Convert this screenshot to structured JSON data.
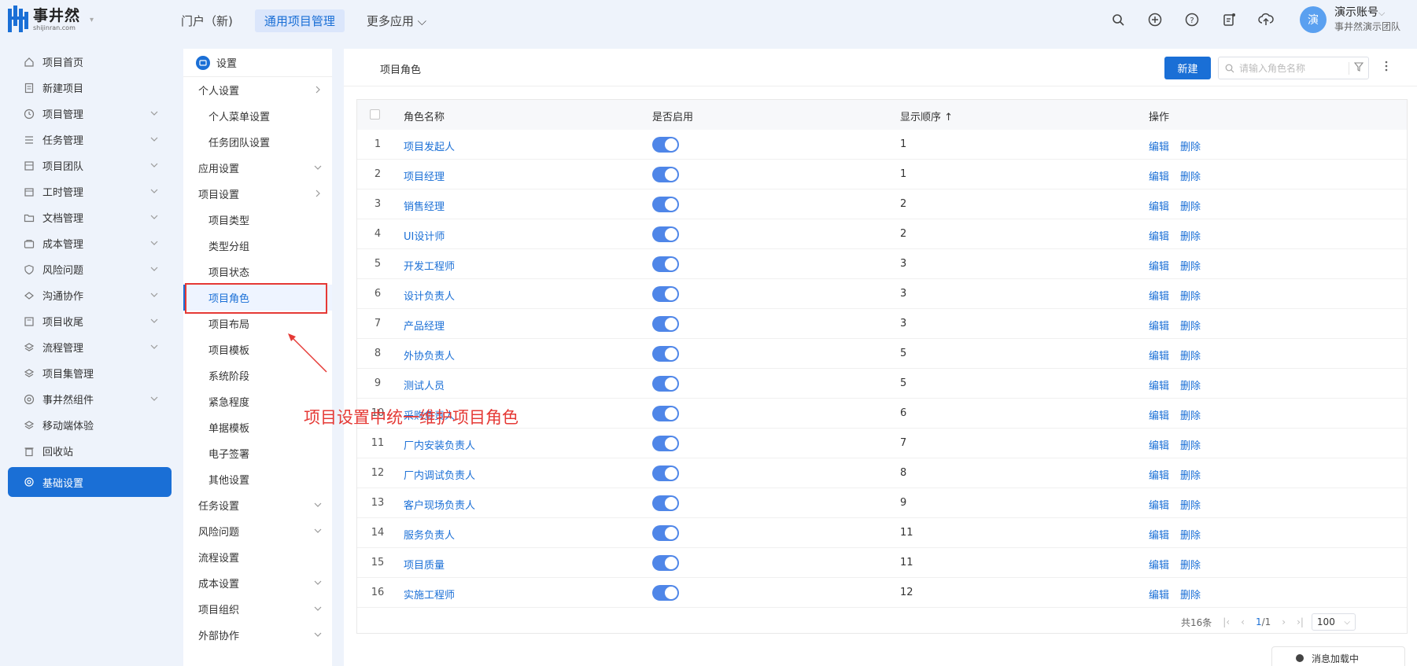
{
  "brand": {
    "name": "事井然",
    "sub": "shijinran.com"
  },
  "topnav": [
    {
      "label": "门户（新)",
      "active": false
    },
    {
      "label": "通用项目管理",
      "active": true
    },
    {
      "label": "更多应用 ⌵",
      "active": false
    }
  ],
  "top_icons": [
    "search-icon",
    "plus-circle-icon",
    "help-icon",
    "notice-icon",
    "cloud-upload-icon"
  ],
  "user": {
    "avatar": "演",
    "name": "演示账号",
    "team": "事井然演示团队"
  },
  "sidebar": [
    {
      "label": "项目首页",
      "icon": "home-icon",
      "chev": false
    },
    {
      "label": "新建项目",
      "icon": "doc-icon",
      "chev": false
    },
    {
      "label": "项目管理",
      "icon": "clock-icon",
      "chev": true
    },
    {
      "label": "任务管理",
      "icon": "list-icon",
      "chev": true
    },
    {
      "label": "项目团队",
      "icon": "team-icon",
      "chev": true
    },
    {
      "label": "工时管理",
      "icon": "calendar-icon",
      "chev": true
    },
    {
      "label": "文档管理",
      "icon": "folder-icon",
      "chev": true
    },
    {
      "label": "成本管理",
      "icon": "wallet-icon",
      "chev": true
    },
    {
      "label": "风险问题",
      "icon": "shield-icon",
      "chev": true
    },
    {
      "label": "沟通协作",
      "icon": "chat-icon",
      "chev": true
    },
    {
      "label": "项目收尾",
      "icon": "archive-icon",
      "chev": true
    },
    {
      "label": "流程管理",
      "icon": "flow-icon",
      "chev": true
    },
    {
      "label": "项目集管理",
      "icon": "layers-icon",
      "chev": false
    },
    {
      "label": "事井然组件",
      "icon": "at-icon",
      "chev": true
    },
    {
      "label": "移动端体验",
      "icon": "mobile-icon",
      "chev": false
    },
    {
      "label": "回收站",
      "icon": "trash-icon",
      "chev": false
    },
    {
      "label": "基础设置",
      "icon": "gear-icon",
      "chev": false,
      "active": true
    }
  ],
  "settings": {
    "title": "设置",
    "items": [
      {
        "label": "个人设置",
        "type": "group",
        "chev": "right"
      },
      {
        "label": "个人菜单设置",
        "type": "sub"
      },
      {
        "label": "任务团队设置",
        "type": "sub"
      },
      {
        "label": "应用设置",
        "type": "group",
        "chev": "down"
      },
      {
        "label": "项目设置",
        "type": "group",
        "chev": "right"
      },
      {
        "label": "项目类型",
        "type": "sub"
      },
      {
        "label": "类型分组",
        "type": "sub"
      },
      {
        "label": "项目状态",
        "type": "sub"
      },
      {
        "label": "项目角色",
        "type": "sub",
        "selected": true
      },
      {
        "label": "项目布局",
        "type": "sub"
      },
      {
        "label": "项目模板",
        "type": "sub"
      },
      {
        "label": "系统阶段",
        "type": "sub"
      },
      {
        "label": "紧急程度",
        "type": "sub"
      },
      {
        "label": "单据模板",
        "type": "sub"
      },
      {
        "label": "电子签署",
        "type": "sub"
      },
      {
        "label": "其他设置",
        "type": "sub"
      },
      {
        "label": "任务设置",
        "type": "group",
        "chev": "down"
      },
      {
        "label": "风险问题",
        "type": "group",
        "chev": "down"
      },
      {
        "label": "流程设置",
        "type": "group"
      },
      {
        "label": "成本设置",
        "type": "group",
        "chev": "down"
      },
      {
        "label": "项目组织",
        "type": "group",
        "chev": "down"
      },
      {
        "label": "外部协作",
        "type": "group",
        "chev": "down"
      }
    ]
  },
  "main": {
    "title": "项目角色",
    "new_label": "新建",
    "search_placeholder": "请输入角色名称",
    "columns": {
      "name": "角色名称",
      "enabled": "是否启用",
      "order": "显示顺序 ↑",
      "ops": "操作"
    },
    "edit_label": "编辑",
    "delete_label": "删除",
    "rows": [
      {
        "idx": "1",
        "name": "项目发起人",
        "order": "1"
      },
      {
        "idx": "2",
        "name": "项目经理",
        "order": "1"
      },
      {
        "idx": "3",
        "name": "销售经理",
        "order": "2"
      },
      {
        "idx": "4",
        "name": "UI设计师",
        "order": "2"
      },
      {
        "idx": "5",
        "name": "开发工程师",
        "order": "3"
      },
      {
        "idx": "6",
        "name": "设计负责人",
        "order": "3"
      },
      {
        "idx": "7",
        "name": "产品经理",
        "order": "3"
      },
      {
        "idx": "8",
        "name": "外协负责人",
        "order": "5"
      },
      {
        "idx": "9",
        "name": "测试人员",
        "order": "5"
      },
      {
        "idx": "10",
        "name": "采购负责人",
        "order": "6"
      },
      {
        "idx": "11",
        "name": "厂内安装负责人",
        "order": "7"
      },
      {
        "idx": "12",
        "name": "厂内调试负责人",
        "order": "8"
      },
      {
        "idx": "13",
        "name": "客户现场负责人",
        "order": "9"
      },
      {
        "idx": "14",
        "name": "服务负责人",
        "order": "11"
      },
      {
        "idx": "15",
        "name": "项目质量",
        "order": "11"
      },
      {
        "idx": "16",
        "name": "实施工程师",
        "order": "12"
      }
    ],
    "pager": {
      "total": "共16条",
      "current": "1",
      "pages": "/1",
      "size": "100"
    }
  },
  "loading_text": "消息加载中",
  "annotation": "项目设置中统一维护项目角色"
}
